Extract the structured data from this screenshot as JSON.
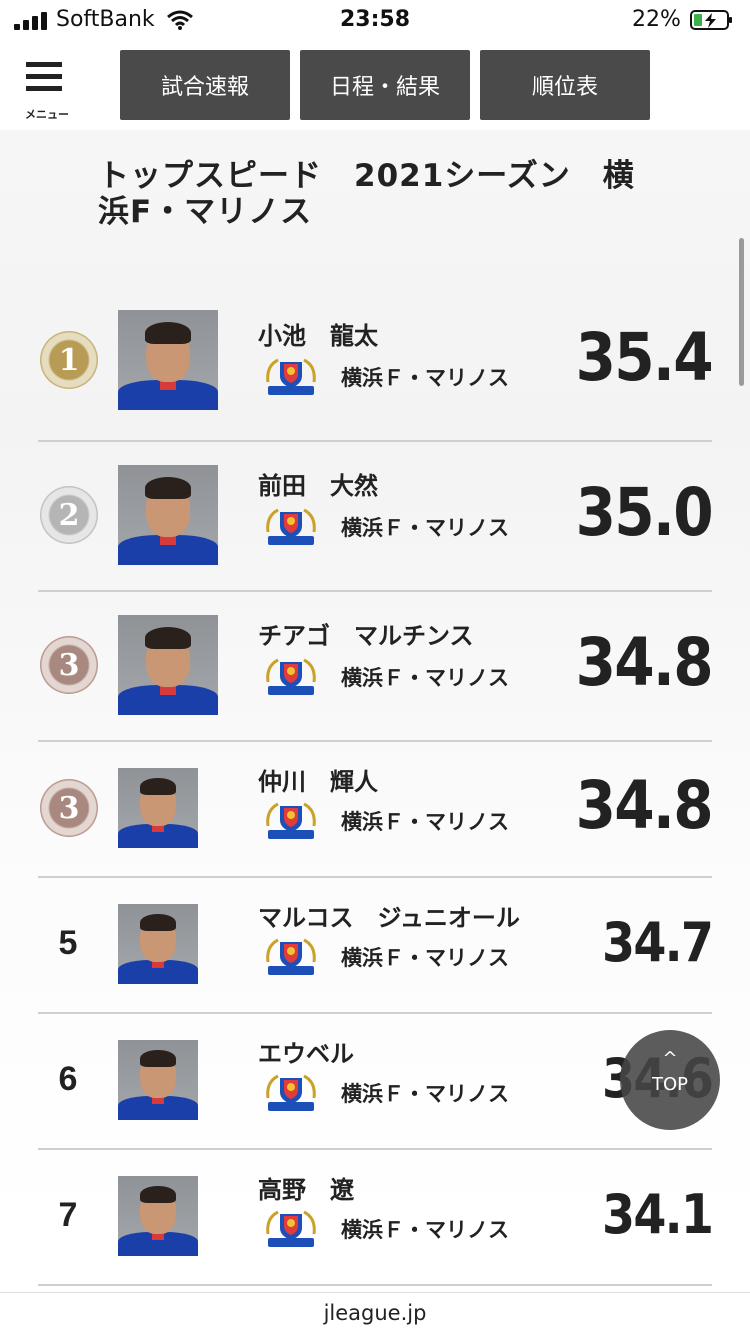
{
  "status_bar": {
    "carrier": "SoftBank",
    "time": "23:58",
    "battery": "22%"
  },
  "nav": {
    "menu_label": "メニュー",
    "tabs": [
      {
        "label": "試合速報"
      },
      {
        "label": "日程・結果"
      },
      {
        "label": "順位表"
      }
    ]
  },
  "title": "トップスピード　2021シーズン　横浜F・マリノス",
  "rows": [
    {
      "rank": "1",
      "medal": "gold",
      "name": "小池　龍太",
      "club": "横浜Ｆ・マリノス",
      "speed": "35.4"
    },
    {
      "rank": "2",
      "medal": "silver",
      "name": "前田　大然",
      "club": "横浜Ｆ・マリノス",
      "speed": "35.0"
    },
    {
      "rank": "3",
      "medal": "bronze",
      "name": "チアゴ　マルチンス",
      "club": "横浜Ｆ・マリノス",
      "speed": "34.8"
    },
    {
      "rank": "3",
      "medal": "bronze",
      "name": "仲川　輝人",
      "club": "横浜Ｆ・マリノス",
      "speed": "34.8"
    },
    {
      "rank": "5",
      "medal": "",
      "name": "マルコス　ジュニオール",
      "club": "横浜Ｆ・マリノス",
      "speed": "34.7"
    },
    {
      "rank": "6",
      "medal": "",
      "name": "エウベル",
      "club": "横浜Ｆ・マリノス",
      "speed": "34.6"
    },
    {
      "rank": "7",
      "medal": "",
      "name": "高野　遼",
      "club": "横浜Ｆ・マリノス",
      "speed": "34.1"
    }
  ],
  "top_button": {
    "label": "TOP",
    "chevron": "^"
  },
  "footer": {
    "domain": "jleague.jp"
  },
  "colors": {
    "tab_bg": "#4a4a4a",
    "gold": "#b89c55",
    "silver": "#b5b5b5",
    "bronze": "#a8887f"
  }
}
